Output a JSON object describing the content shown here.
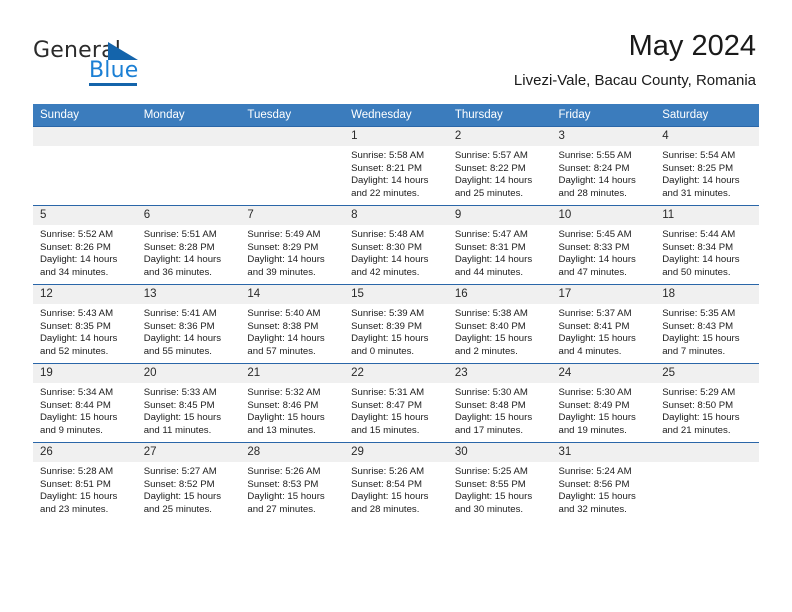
{
  "brand": {
    "name_part1": "General",
    "name_part2": "Blue",
    "logo_icon": "triangle-flag-icon",
    "accent_color": "#1464ab",
    "blue_text_color": "#1b7fd4"
  },
  "header": {
    "month_title": "May 2024",
    "location": "Livezi-Vale, Bacau County, Romania"
  },
  "calendar": {
    "header_bg": "#3b7cbd",
    "header_text_color": "#ffffff",
    "daynum_bg": "#f0f0f0",
    "row_border_color": "#2a66a8",
    "weekdays": [
      "Sunday",
      "Monday",
      "Tuesday",
      "Wednesday",
      "Thursday",
      "Friday",
      "Saturday"
    ],
    "weeks": [
      [
        {
          "day": "",
          "lines": []
        },
        {
          "day": "",
          "lines": []
        },
        {
          "day": "",
          "lines": []
        },
        {
          "day": "1",
          "lines": [
            "Sunrise: 5:58 AM",
            "Sunset: 8:21 PM",
            "Daylight: 14 hours",
            "and 22 minutes."
          ]
        },
        {
          "day": "2",
          "lines": [
            "Sunrise: 5:57 AM",
            "Sunset: 8:22 PM",
            "Daylight: 14 hours",
            "and 25 minutes."
          ]
        },
        {
          "day": "3",
          "lines": [
            "Sunrise: 5:55 AM",
            "Sunset: 8:24 PM",
            "Daylight: 14 hours",
            "and 28 minutes."
          ]
        },
        {
          "day": "4",
          "lines": [
            "Sunrise: 5:54 AM",
            "Sunset: 8:25 PM",
            "Daylight: 14 hours",
            "and 31 minutes."
          ]
        }
      ],
      [
        {
          "day": "5",
          "lines": [
            "Sunrise: 5:52 AM",
            "Sunset: 8:26 PM",
            "Daylight: 14 hours",
            "and 34 minutes."
          ]
        },
        {
          "day": "6",
          "lines": [
            "Sunrise: 5:51 AM",
            "Sunset: 8:28 PM",
            "Daylight: 14 hours",
            "and 36 minutes."
          ]
        },
        {
          "day": "7",
          "lines": [
            "Sunrise: 5:49 AM",
            "Sunset: 8:29 PM",
            "Daylight: 14 hours",
            "and 39 minutes."
          ]
        },
        {
          "day": "8",
          "lines": [
            "Sunrise: 5:48 AM",
            "Sunset: 8:30 PM",
            "Daylight: 14 hours",
            "and 42 minutes."
          ]
        },
        {
          "day": "9",
          "lines": [
            "Sunrise: 5:47 AM",
            "Sunset: 8:31 PM",
            "Daylight: 14 hours",
            "and 44 minutes."
          ]
        },
        {
          "day": "10",
          "lines": [
            "Sunrise: 5:45 AM",
            "Sunset: 8:33 PM",
            "Daylight: 14 hours",
            "and 47 minutes."
          ]
        },
        {
          "day": "11",
          "lines": [
            "Sunrise: 5:44 AM",
            "Sunset: 8:34 PM",
            "Daylight: 14 hours",
            "and 50 minutes."
          ]
        }
      ],
      [
        {
          "day": "12",
          "lines": [
            "Sunrise: 5:43 AM",
            "Sunset: 8:35 PM",
            "Daylight: 14 hours",
            "and 52 minutes."
          ]
        },
        {
          "day": "13",
          "lines": [
            "Sunrise: 5:41 AM",
            "Sunset: 8:36 PM",
            "Daylight: 14 hours",
            "and 55 minutes."
          ]
        },
        {
          "day": "14",
          "lines": [
            "Sunrise: 5:40 AM",
            "Sunset: 8:38 PM",
            "Daylight: 14 hours",
            "and 57 minutes."
          ]
        },
        {
          "day": "15",
          "lines": [
            "Sunrise: 5:39 AM",
            "Sunset: 8:39 PM",
            "Daylight: 15 hours",
            "and 0 minutes."
          ]
        },
        {
          "day": "16",
          "lines": [
            "Sunrise: 5:38 AM",
            "Sunset: 8:40 PM",
            "Daylight: 15 hours",
            "and 2 minutes."
          ]
        },
        {
          "day": "17",
          "lines": [
            "Sunrise: 5:37 AM",
            "Sunset: 8:41 PM",
            "Daylight: 15 hours",
            "and 4 minutes."
          ]
        },
        {
          "day": "18",
          "lines": [
            "Sunrise: 5:35 AM",
            "Sunset: 8:43 PM",
            "Daylight: 15 hours",
            "and 7 minutes."
          ]
        }
      ],
      [
        {
          "day": "19",
          "lines": [
            "Sunrise: 5:34 AM",
            "Sunset: 8:44 PM",
            "Daylight: 15 hours",
            "and 9 minutes."
          ]
        },
        {
          "day": "20",
          "lines": [
            "Sunrise: 5:33 AM",
            "Sunset: 8:45 PM",
            "Daylight: 15 hours",
            "and 11 minutes."
          ]
        },
        {
          "day": "21",
          "lines": [
            "Sunrise: 5:32 AM",
            "Sunset: 8:46 PM",
            "Daylight: 15 hours",
            "and 13 minutes."
          ]
        },
        {
          "day": "22",
          "lines": [
            "Sunrise: 5:31 AM",
            "Sunset: 8:47 PM",
            "Daylight: 15 hours",
            "and 15 minutes."
          ]
        },
        {
          "day": "23",
          "lines": [
            "Sunrise: 5:30 AM",
            "Sunset: 8:48 PM",
            "Daylight: 15 hours",
            "and 17 minutes."
          ]
        },
        {
          "day": "24",
          "lines": [
            "Sunrise: 5:30 AM",
            "Sunset: 8:49 PM",
            "Daylight: 15 hours",
            "and 19 minutes."
          ]
        },
        {
          "day": "25",
          "lines": [
            "Sunrise: 5:29 AM",
            "Sunset: 8:50 PM",
            "Daylight: 15 hours",
            "and 21 minutes."
          ]
        }
      ],
      [
        {
          "day": "26",
          "lines": [
            "Sunrise: 5:28 AM",
            "Sunset: 8:51 PM",
            "Daylight: 15 hours",
            "and 23 minutes."
          ]
        },
        {
          "day": "27",
          "lines": [
            "Sunrise: 5:27 AM",
            "Sunset: 8:52 PM",
            "Daylight: 15 hours",
            "and 25 minutes."
          ]
        },
        {
          "day": "28",
          "lines": [
            "Sunrise: 5:26 AM",
            "Sunset: 8:53 PM",
            "Daylight: 15 hours",
            "and 27 minutes."
          ]
        },
        {
          "day": "29",
          "lines": [
            "Sunrise: 5:26 AM",
            "Sunset: 8:54 PM",
            "Daylight: 15 hours",
            "and 28 minutes."
          ]
        },
        {
          "day": "30",
          "lines": [
            "Sunrise: 5:25 AM",
            "Sunset: 8:55 PM",
            "Daylight: 15 hours",
            "and 30 minutes."
          ]
        },
        {
          "day": "31",
          "lines": [
            "Sunrise: 5:24 AM",
            "Sunset: 8:56 PM",
            "Daylight: 15 hours",
            "and 32 minutes."
          ]
        },
        {
          "day": "",
          "lines": []
        }
      ]
    ]
  }
}
